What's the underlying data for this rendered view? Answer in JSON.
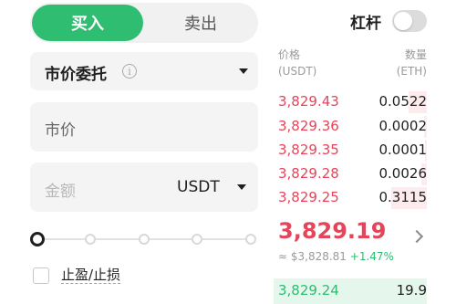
{
  "side": {
    "buy": "买入",
    "sell": "卖出"
  },
  "leverage": {
    "label": "杠杆",
    "enabled": false
  },
  "order_type": {
    "label": "市价委托",
    "info_icon": "info-icon"
  },
  "price_field": {
    "label": "市价"
  },
  "amount_field": {
    "placeholder": "金额",
    "unit": "USDT"
  },
  "slider": {
    "value_percent": 0,
    "stops": [
      0,
      25,
      50,
      75,
      100
    ]
  },
  "tpsl": {
    "label": "止盈/止损",
    "checked": false
  },
  "order_book": {
    "price_header": [
      "价格",
      "(USDT)"
    ],
    "qty_header": [
      "数量",
      "(ETH)"
    ],
    "asks": [
      {
        "price": "3,829.43",
        "qty": "0.0522",
        "depth": 0.18
      },
      {
        "price": "3,829.36",
        "qty": "0.0002",
        "depth": 0.03
      },
      {
        "price": "3,829.35",
        "qty": "0.0001",
        "depth": 0.02
      },
      {
        "price": "3,829.28",
        "qty": "0.0026",
        "depth": 0.05
      },
      {
        "price": "3,829.25",
        "qty": "0.3115",
        "depth": 0.35
      }
    ],
    "last_price": "3,829.19",
    "ref_price": "≈ $3,828.81",
    "change": "+1.47%",
    "bids": [
      {
        "price": "3,829.24",
        "qty": "19.9"
      }
    ]
  },
  "colors": {
    "buy": "#2ebd71",
    "sell": "#e5455a"
  }
}
